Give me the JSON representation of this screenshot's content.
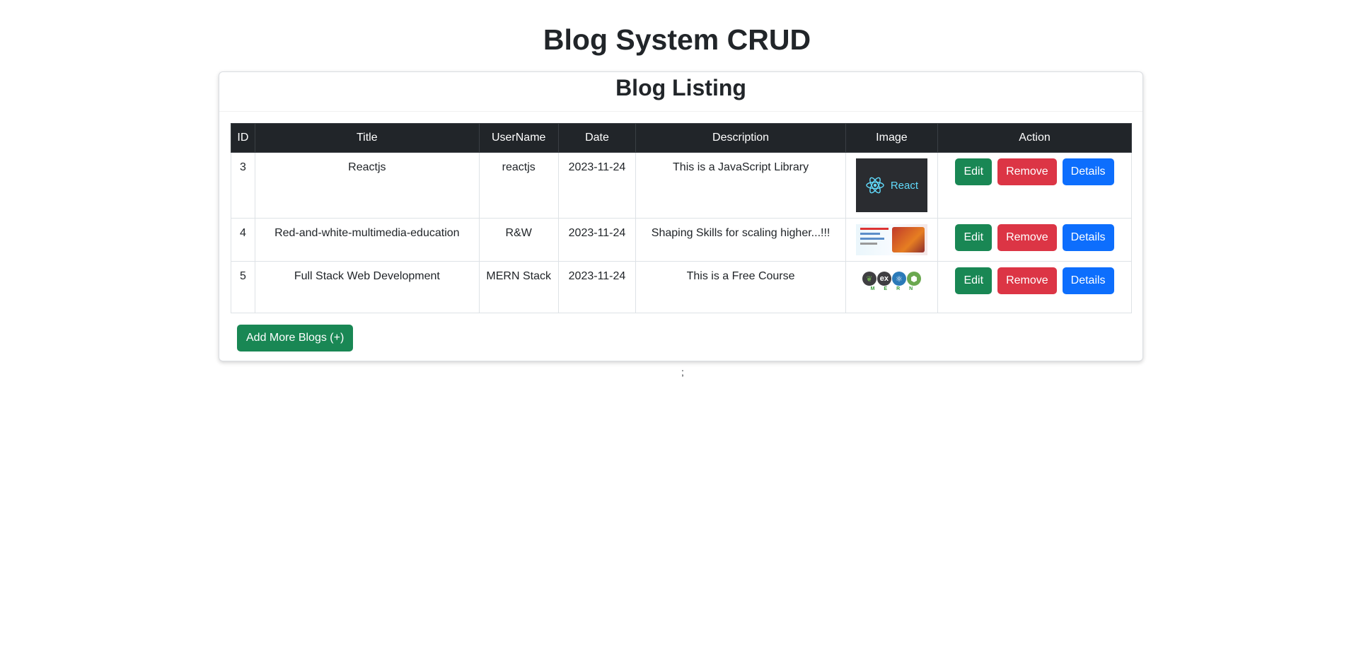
{
  "page": {
    "title": "Blog System CRUD",
    "footer_text": ";"
  },
  "card": {
    "header": "Blog Listing",
    "add_button_label": "Add More Blogs (+)"
  },
  "table": {
    "columns": [
      "ID",
      "Title",
      "UserName",
      "Date",
      "Description",
      "Image",
      "Action"
    ],
    "rows": [
      {
        "id": "3",
        "title": "Reactjs",
        "username": "reactjs",
        "date": "2023-11-24",
        "description": "This is a JavaScript Library",
        "image_label": "React"
      },
      {
        "id": "4",
        "title": "Red-and-white-multimedia-education",
        "username": "R&W",
        "date": "2023-11-24",
        "description": "Shaping Skills for scaling higher...!!!",
        "image_label": ""
      },
      {
        "id": "5",
        "title": "Full Stack Web Development",
        "username": "MERN Stack",
        "date": "2023-11-24",
        "description": "This is a Free Course",
        "image_label": ""
      }
    ],
    "actions": {
      "edit": "Edit",
      "remove": "Remove",
      "details": "Details"
    }
  },
  "mern_logo": {
    "letters": [
      "M",
      "E",
      "R",
      "N"
    ],
    "glyphs": [
      "❦",
      "ex",
      "⚛",
      "⬢"
    ],
    "colors": [
      "#3f3e42",
      "#3f3e42",
      "#2b7ab8",
      "#6aa84f"
    ]
  },
  "colors": {
    "header_bg": "#212529",
    "success": "#198754",
    "danger": "#dc3545",
    "primary": "#0d6efd",
    "react_blue": "#61dafb"
  }
}
